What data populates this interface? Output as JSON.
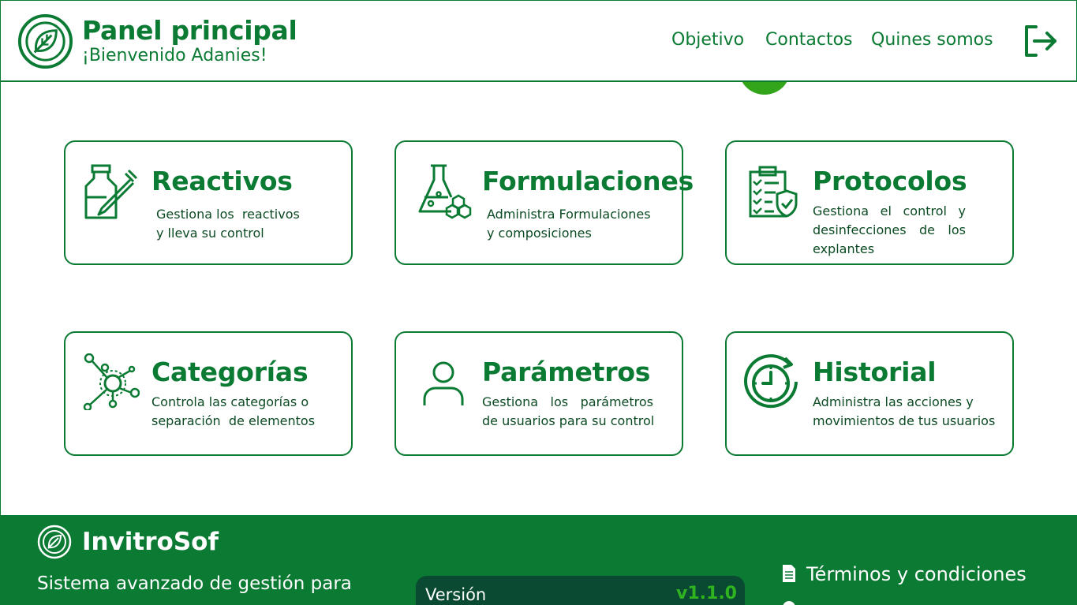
{
  "header": {
    "title": "Panel principal",
    "subtitle": "¡Bienvenido Adanies!",
    "nav": [
      "Objetivo",
      "Contactos",
      "Quines somos"
    ],
    "logo_icon": "leaf-icon",
    "logout_icon": "logout-icon"
  },
  "cards": [
    {
      "title": "Reactivos",
      "description_lines": [
        "Gestiona los  reactivos",
        "y lleva su control"
      ],
      "icon": "reagent-bottle-dropper-icon"
    },
    {
      "title": "Formulaciones",
      "description_lines": [
        "Administra Formulaciones",
        "y composiciones"
      ],
      "icon": "flask-icon"
    },
    {
      "title": "Protocolos",
      "description_lines": [
        "Gestiona el control y",
        "desinfecciones de los",
        "explantes"
      ],
      "icon": "clipboard-checklist-icon"
    },
    {
      "title": "Categorías",
      "description_lines": [
        "Controla las categorías o",
        "separación  de elementos"
      ],
      "icon": "network-nodes-icon"
    },
    {
      "title": "Parámetros",
      "description_lines": [
        "Gestiona los parámetros",
        "de usuarios para su control"
      ],
      "icon": "user-icon"
    },
    {
      "title": "Historial",
      "description_lines": [
        "Administra las acciones y",
        "movimientos de tus usuarios"
      ],
      "icon": "history-clock-icon"
    }
  ],
  "footer": {
    "brand": "InvitroSof",
    "description": "Sistema avanzado de gestión para",
    "version_label": "Versión",
    "version_number": "v1.1.0",
    "links": [
      "Términos y condiciones"
    ]
  },
  "colors": {
    "primary": "#0b7a33",
    "accent": "#33a51a",
    "footer_box": "#0a4a33",
    "version_text": "#2fb31f"
  }
}
